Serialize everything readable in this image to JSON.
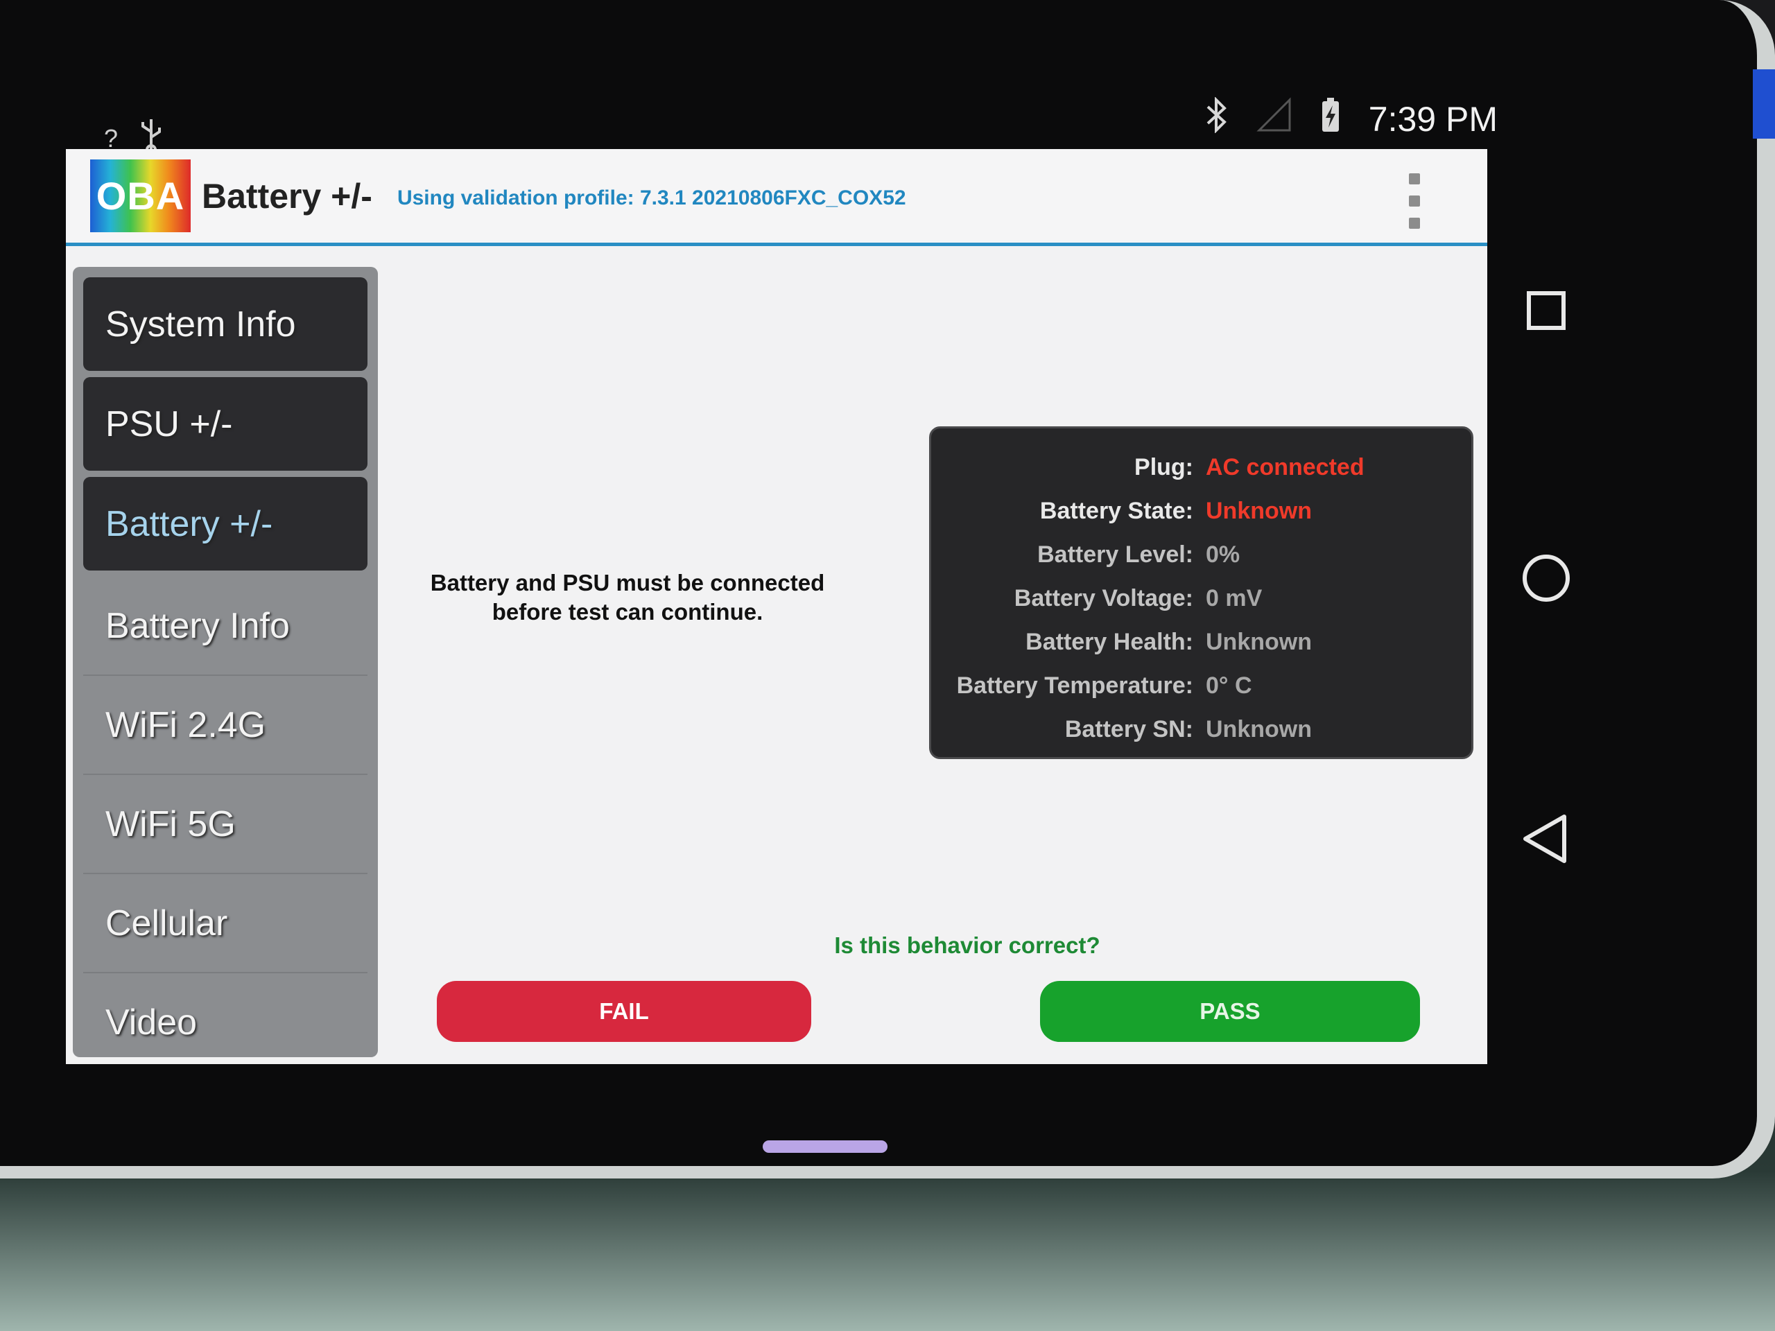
{
  "status_bar": {
    "left_icons": [
      "question-icon",
      "usb-icon"
    ],
    "right_icons": [
      "bluetooth-icon",
      "signal-icon",
      "battery-charging-icon"
    ],
    "time": "7:39 PM"
  },
  "appbar": {
    "logo_text": "OBA",
    "title": "Battery +/-",
    "profile": "Using validation profile: 7.3.1 20210806FXC_COX52"
  },
  "sidebar": {
    "items": [
      {
        "label": "System Info"
      },
      {
        "label": "PSU +/-"
      },
      {
        "label": "Battery +/-"
      },
      {
        "label": "Battery Info"
      },
      {
        "label": "WiFi 2.4G"
      },
      {
        "label": "WiFi 5G"
      },
      {
        "label": "Cellular"
      },
      {
        "label": "Video"
      }
    ],
    "selected": "Battery +/-"
  },
  "main": {
    "message_line1": "Battery and PSU must be connected",
    "message_line2": "before test can continue.",
    "info": [
      {
        "label": "Plug:",
        "value": "AC connected"
      },
      {
        "label": "Battery State:",
        "value": "Unknown"
      },
      {
        "label": "Battery Level:",
        "value": "0%"
      },
      {
        "label": "Battery Voltage:",
        "value": "0 mV"
      },
      {
        "label": "Battery Health:",
        "value": "Unknown"
      },
      {
        "label": "Battery Temperature:",
        "value": "0° C"
      },
      {
        "label": "Battery SN:",
        "value": "Unknown"
      }
    ],
    "question": "Is this behavior correct?",
    "fail_label": "FAIL",
    "pass_label": "PASS"
  },
  "colors": {
    "accent": "#2a8fc4",
    "fail": "#d7283e",
    "pass": "#17a22c",
    "warning_text": "#f03a2a",
    "question_text": "#1e8a35"
  }
}
